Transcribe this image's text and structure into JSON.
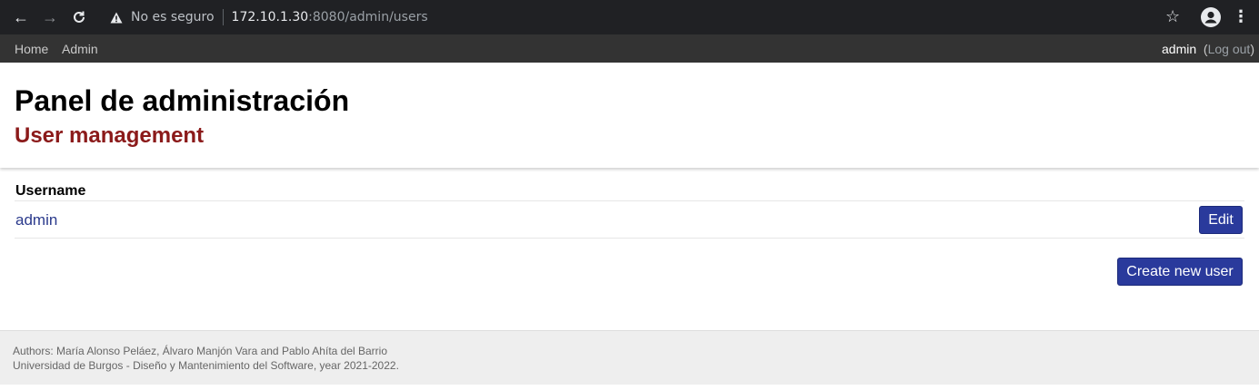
{
  "browser": {
    "security_label": "No es seguro",
    "url_host": "172.10.1.30",
    "url_rest": ":8080/admin/users"
  },
  "navbar": {
    "home": "Home",
    "admin": "Admin",
    "user": "admin",
    "logout": "Log out"
  },
  "header": {
    "title": "Panel de administración",
    "subtitle": "User management"
  },
  "users_table": {
    "column_username": "Username",
    "rows": [
      {
        "username": "admin",
        "edit_label": "Edit"
      }
    ]
  },
  "actions": {
    "create_user": "Create new user"
  },
  "footer": {
    "line1": "Authors: María Alonso Peláez, Álvaro Manjón Vara and Pablo Ahíta del Barrio",
    "line2": "Universidad de Burgos - Diseño y Mantenimiento del Software, year 2021-2022."
  }
}
